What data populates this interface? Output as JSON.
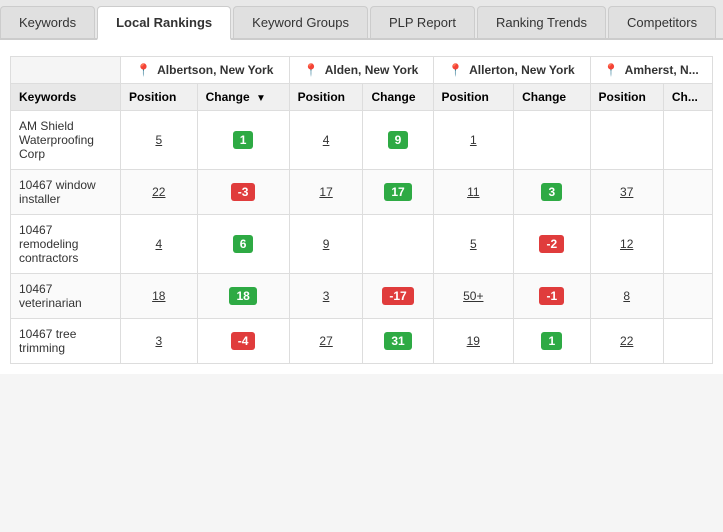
{
  "tabs": [
    {
      "label": "Keywords",
      "active": false
    },
    {
      "label": "Local Rankings",
      "active": true
    },
    {
      "label": "Keyword Groups",
      "active": false
    },
    {
      "label": "PLP Report",
      "active": false
    },
    {
      "label": "Ranking Trends",
      "active": false
    },
    {
      "label": "Competitors",
      "active": false
    }
  ],
  "table": {
    "keyword_col_label": "Keywords",
    "locations": [
      {
        "name": "Albertson, New York",
        "cols": [
          "Position",
          "Change"
        ]
      },
      {
        "name": "Alden, New York",
        "cols": [
          "Position",
          "Change"
        ]
      },
      {
        "name": "Allerton, New York",
        "cols": [
          "Position",
          "Change"
        ]
      },
      {
        "name": "Amherst, N...",
        "cols": [
          "Position",
          "Ch..."
        ]
      }
    ],
    "rows": [
      {
        "keyword": "AM Shield Waterproofing Corp",
        "data": [
          {
            "position": "5",
            "change": "1",
            "change_type": "pos"
          },
          {
            "position": "4",
            "change": "9",
            "change_type": "pos"
          },
          {
            "position": "1",
            "change": "",
            "change_type": "none"
          },
          {
            "position": "",
            "change": "",
            "change_type": "none"
          }
        ]
      },
      {
        "keyword": "10467 window installer",
        "data": [
          {
            "position": "22",
            "change": "-3",
            "change_type": "neg"
          },
          {
            "position": "17",
            "change": "17",
            "change_type": "pos"
          },
          {
            "position": "11",
            "change": "3",
            "change_type": "pos"
          },
          {
            "position": "37",
            "change": "",
            "change_type": "none"
          }
        ]
      },
      {
        "keyword": "10467 remodeling contractors",
        "data": [
          {
            "position": "4",
            "change": "6",
            "change_type": "pos"
          },
          {
            "position": "9",
            "change": "",
            "change_type": "none"
          },
          {
            "position": "5",
            "change": "-2",
            "change_type": "neg"
          },
          {
            "position": "12",
            "change": "",
            "change_type": "none"
          }
        ]
      },
      {
        "keyword": "10467 veterinarian",
        "data": [
          {
            "position": "18",
            "change": "18",
            "change_type": "pos"
          },
          {
            "position": "3",
            "change": "-17",
            "change_type": "neg"
          },
          {
            "position": "50+",
            "change": "-1",
            "change_type": "neg"
          },
          {
            "position": "8",
            "change": "",
            "change_type": "none"
          }
        ]
      },
      {
        "keyword": "10467 tree trimming",
        "data": [
          {
            "position": "3",
            "change": "-4",
            "change_type": "neg"
          },
          {
            "position": "27",
            "change": "31",
            "change_type": "pos"
          },
          {
            "position": "19",
            "change": "1",
            "change_type": "pos"
          },
          {
            "position": "22",
            "change": "",
            "change_type": "none"
          }
        ]
      }
    ]
  }
}
